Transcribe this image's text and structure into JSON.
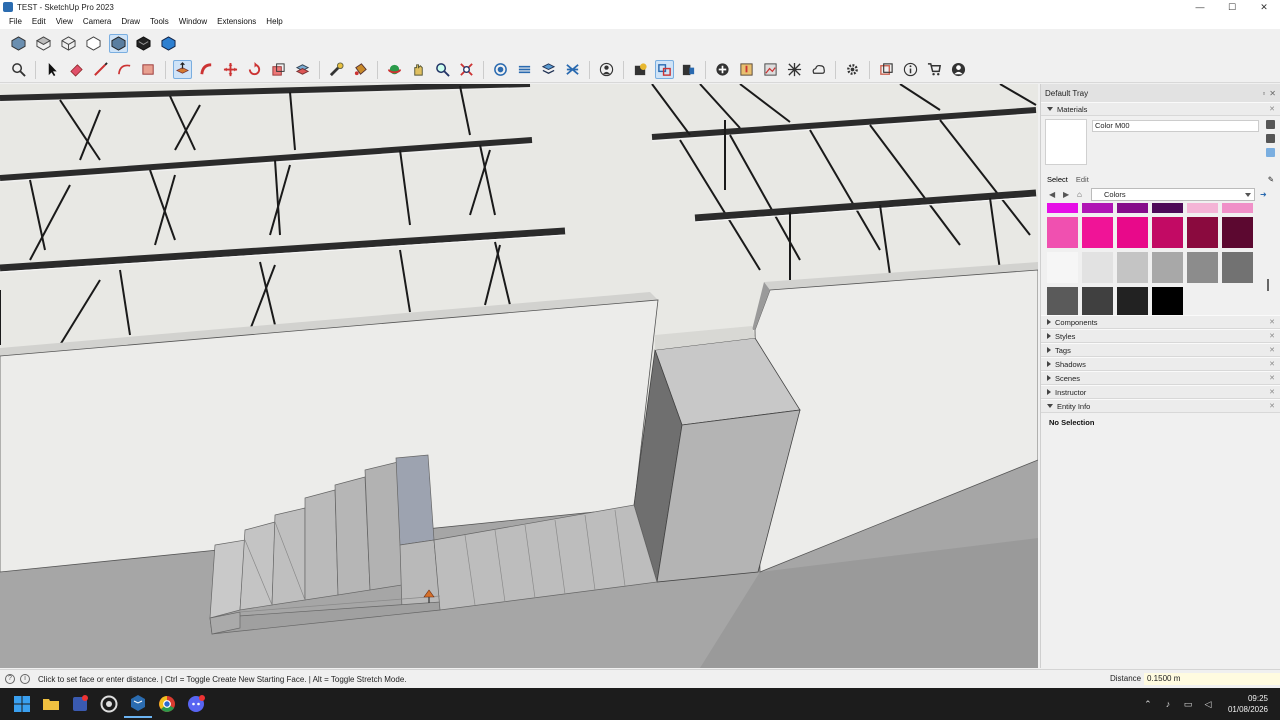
{
  "window": {
    "title": "TEST - SketchUp Pro 2023",
    "controls": [
      "—",
      "☐",
      "✕"
    ]
  },
  "menu": [
    "File",
    "Edit",
    "View",
    "Camera",
    "Draw",
    "Tools",
    "Window",
    "Extensions",
    "Help"
  ],
  "toolbar_top": [
    "iso-view-icon",
    "top-view-icon",
    "front-view-icon",
    "right-view-icon",
    "back-view-icon",
    "left-view-icon",
    "bottom-view-icon"
  ],
  "toolbar_main": [
    "search-icon",
    "select-icon",
    "eraser-icon",
    "line-icon",
    "arc-icon",
    "rectangle-icon",
    "push-pull-icon",
    "follow-me-icon",
    "move-icon",
    "rotate-icon",
    "scale-icon",
    "offset-icon",
    "tape-measure-icon",
    "paint-bucket-icon",
    "orbit-icon",
    "pan-icon",
    "zoom-icon",
    "zoom-extents-icon",
    "section-plane-icon",
    "display-section-icon",
    "layers-icon",
    "xray-icon",
    "user-icon",
    "warehouse-icon",
    "extension-manager-icon",
    "scene-icon",
    "add-location-icon",
    "geo-icon",
    "photo-texture-icon",
    "grid-icon",
    "cloud-icon",
    "settings-icon",
    "outliner-icon",
    "info-icon",
    "cart-icon",
    "account-icon"
  ],
  "tray": {
    "title": "Default Tray",
    "materials": {
      "header": "Materials",
      "name": "Color M00",
      "tab_select": "Select",
      "tab_edit": "Edit",
      "library": "Colors",
      "swatches": [
        "#e60ee6",
        "#b015b4",
        "#850d8a",
        "#4e0a58",
        "#f4b4d6",
        "#f090c8",
        "#f050b0",
        "#f01497",
        "#e8098a",
        "#c20a64",
        "#8a0a3e",
        "#5c0830",
        "#f6f6f6",
        "#e2e2e2",
        "#c4c4c4",
        "#a8a8a8",
        "#8c8c8c",
        "#727272",
        "#5a5a5a",
        "#404040",
        "#222222",
        "#000000"
      ]
    },
    "panels": [
      "Components",
      "Styles",
      "Tags",
      "Shadows",
      "Scenes",
      "Instructor"
    ],
    "entity_info": {
      "header": "Entity Info",
      "status": "No Selection"
    }
  },
  "statusbar": {
    "message": "Click to set face or enter distance. | Ctrl = Toggle Create New Starting Face. | Alt = Toggle Stretch Mode.",
    "distance_label": "Distance",
    "distance_value": "0.1500 m"
  },
  "taskbar": {
    "apps": [
      "windows-start-icon",
      "file-explorer-icon",
      "app-icon",
      "chrome-variant-icon",
      "sketchup-icon",
      "chrome-icon",
      "discord-icon"
    ],
    "time": "09:25",
    "date": "01/08/2026"
  }
}
